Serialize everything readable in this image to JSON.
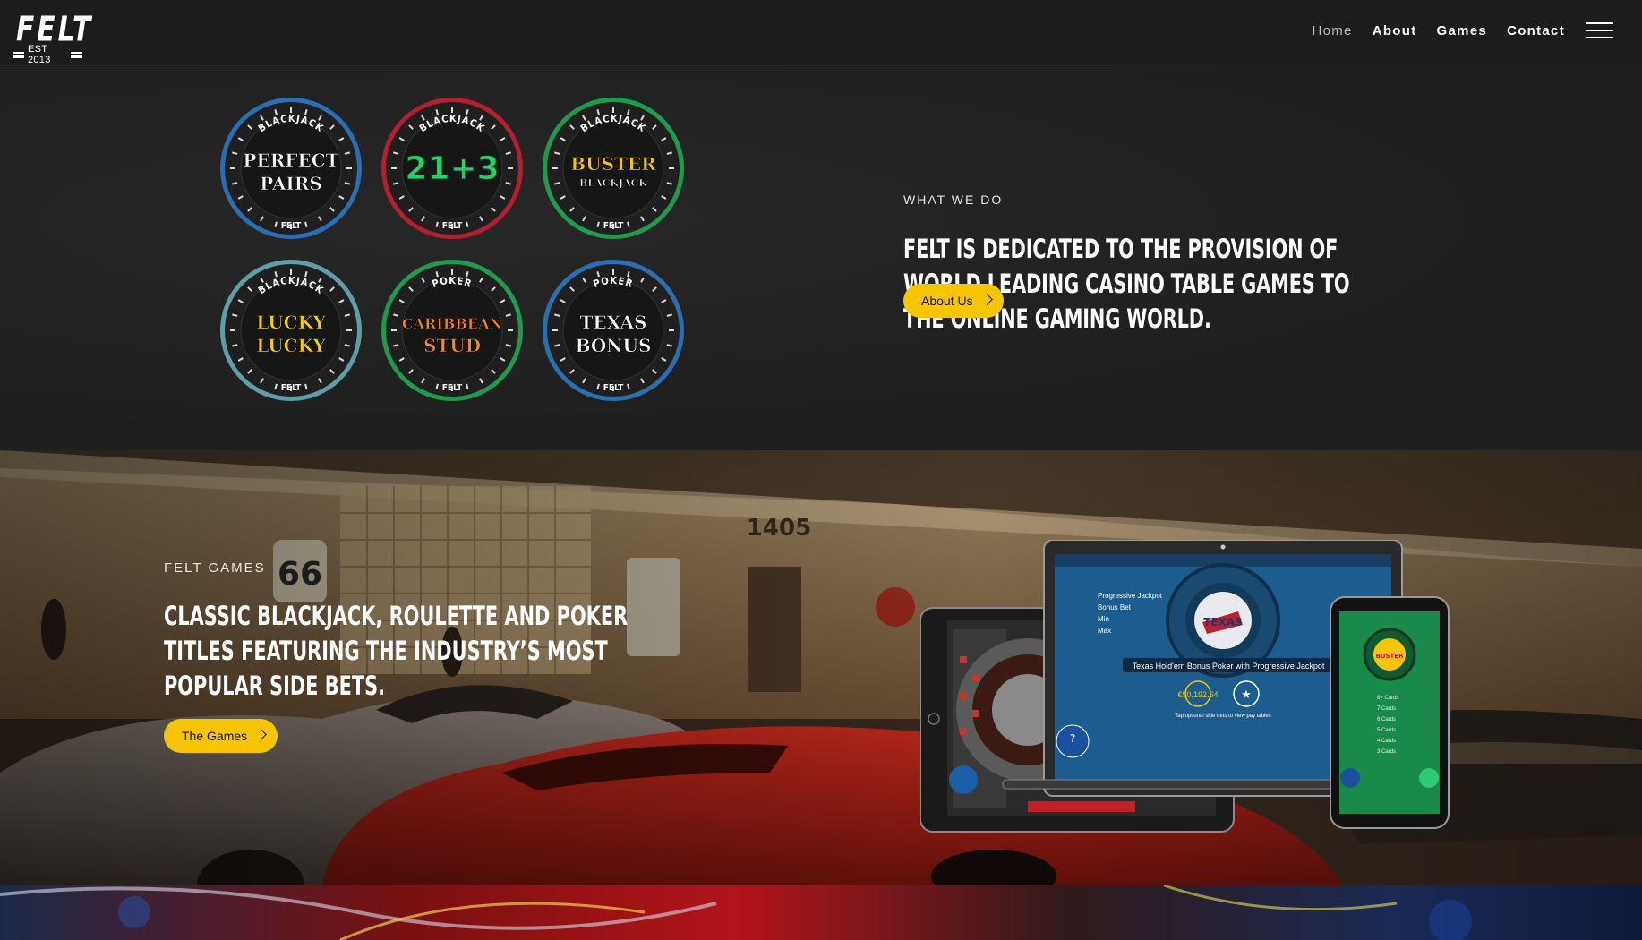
{
  "header": {
    "logo_text": "FELT",
    "logo_est": "EST 2013",
    "nav": [
      {
        "label": "Home"
      },
      {
        "label": "About"
      },
      {
        "label": "Games"
      },
      {
        "label": "Contact"
      }
    ],
    "menu_icon": "hamburger-icon"
  },
  "what_we_do": {
    "eyebrow": "WHAT WE DO",
    "heading": "FELT IS DEDICATED TO THE PROVISION OF WORLD LEADING CASINO TABLE GAMES TO THE ONLINE GAMING WORLD.",
    "button_label": "About Us",
    "chips": [
      {
        "top": "BLACKJACK",
        "line1": "PERFECT",
        "line2": "PAIRS",
        "bottom": "FELT",
        "ring": "#2b6fb3",
        "accent": "#ffffff"
      },
      {
        "top": "BLACKJACK",
        "line1": "21+3",
        "line2": "",
        "bottom": "FELT",
        "ring": "#b32030",
        "accent": "#2ecc71"
      },
      {
        "top": "BLACKJACK",
        "line1": "BUSTER",
        "line2": "BLACKJACK",
        "bottom": "FELT",
        "ring": "#1f9b4d",
        "accent": "#f7c600"
      },
      {
        "top": "BLACKJACK",
        "line1": "LUCKY",
        "line2": "LUCKY",
        "bottom": "FELT",
        "ring": "#5f9ea8",
        "accent": "#f7d000"
      },
      {
        "top": "POKER",
        "line1": "CARIBBEAN",
        "line2": "STUD",
        "bottom": "FELT",
        "ring": "#1f9b4d",
        "accent": "#f58a1f"
      },
      {
        "top": "POKER",
        "line1": "TEXAS",
        "line2": "BONUS",
        "bottom": "FELT",
        "ring": "#2b6fb3",
        "accent": "#ffffff"
      }
    ]
  },
  "games": {
    "eyebrow": "FELT GAMES",
    "heading": "CLASSIC BLACKJACK, ROULETTE AND POKER TITLES FEATURING THE INDUSTRY’S MOST POPULAR SIDE BETS.",
    "button_label": "The Games",
    "sign_number": "1405",
    "route_sign": "66",
    "tablet_caption": "Texas Hold'em Bonus Poker with Progressive Jackpot",
    "tablet_jackpot": "€50,192.64",
    "tablet_hint": "Tap optional side bets to view pay tables"
  },
  "colors": {
    "accent": "#f7c600",
    "header_bg": "#1c1c1c",
    "section_bg": "#1e1e1e"
  }
}
